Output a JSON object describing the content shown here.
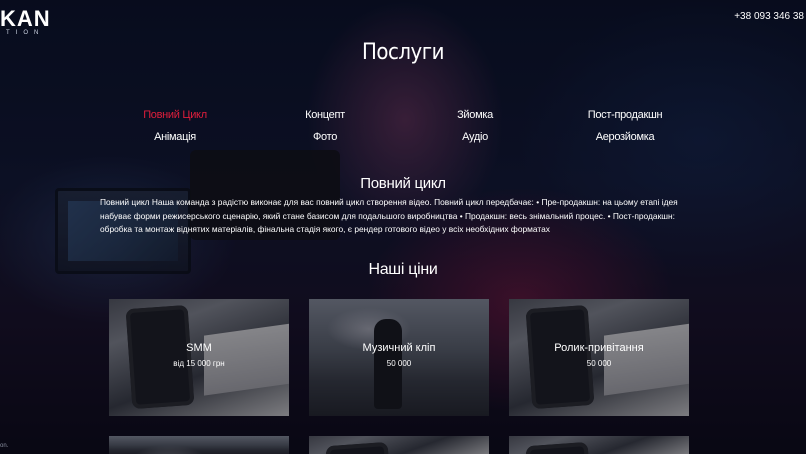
{
  "header": {
    "logo_text": "KAN",
    "logo_sub": "TION",
    "phone": "+38 093 346 38"
  },
  "services": {
    "title": "Послуги",
    "tabs": [
      {
        "label": "Повний Цикл",
        "active": true
      },
      {
        "label": "Концепт",
        "active": false
      },
      {
        "label": "Зйомка",
        "active": false
      },
      {
        "label": "Пост-продакшн",
        "active": false
      },
      {
        "label": "Анімація",
        "active": false
      },
      {
        "label": "Фото",
        "active": false
      },
      {
        "label": "Аудіо",
        "active": false
      },
      {
        "label": "Аерозйомка",
        "active": false
      }
    ],
    "active_color": "#e01e3c"
  },
  "detail": {
    "title": "Повний цикл",
    "text": "Повний цикл Наша команда з радістю виконає для вас повний цикл створення відео. Повний цикл передбачає: • Пре-продакшн: на цьому етапі ідея набуває форми режисерського сценарію, який стане базисом для подальшого виробництва • Продакшн: весь знімальний процес. • Пост-продакшн: обробка та монтаж віднятих матеріалів, фінальна стадія якого, є рендер готового відео у всіх необхідних форматах"
  },
  "prices": {
    "title": "Наші ціни",
    "cards": [
      {
        "name": "SMM",
        "price": "від 15 000 грн",
        "image": "laptop-phone"
      },
      {
        "name": "Музичний кліп",
        "price": "50 000",
        "image": "beach-silhouette"
      },
      {
        "name": "Ролик-привітання",
        "price": "50 000",
        "image": "laptop-phone"
      }
    ]
  },
  "footer": {
    "text": "on."
  }
}
